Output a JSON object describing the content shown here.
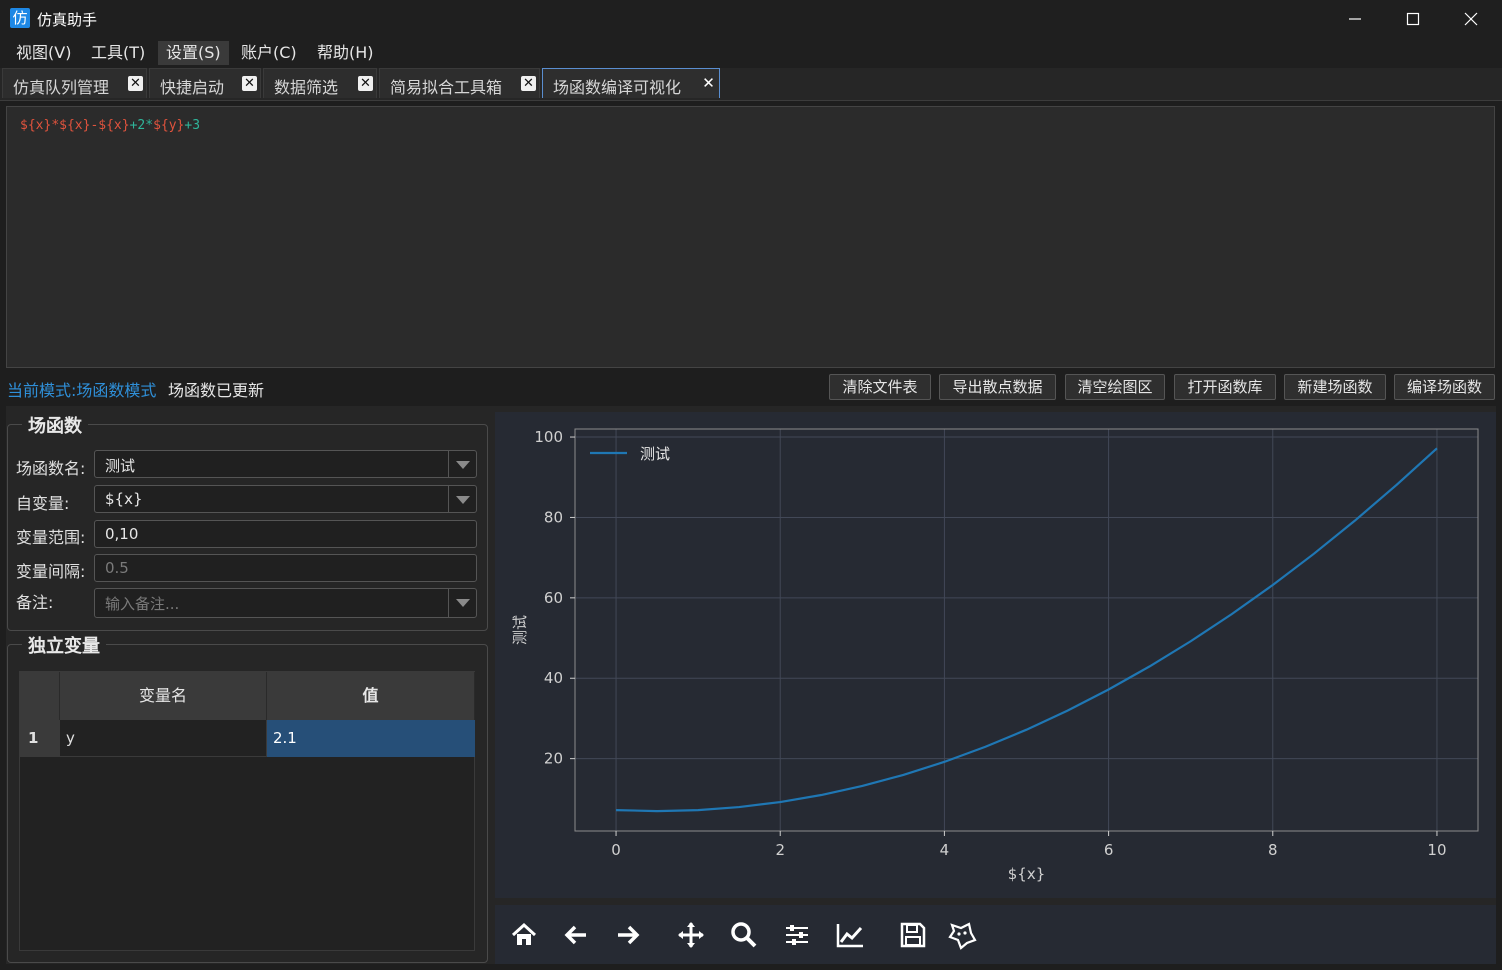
{
  "window": {
    "title": "仿真助手",
    "icon_glyph": "仿"
  },
  "menu": [
    "视图(V)",
    "工具(T)",
    "设置(S)",
    "账户(C)",
    "帮助(H)"
  ],
  "tabs": [
    "仿真队列管理",
    "快捷启动",
    "数据筛选",
    "简易拟合工具箱",
    "场函数编译可视化"
  ],
  "editor": {
    "tokens": [
      {
        "t": "${x}",
        "k": "var"
      },
      {
        "t": "*",
        "k": "var"
      },
      {
        "t": "${x}",
        "k": "var"
      },
      {
        "t": "-",
        "k": "var"
      },
      {
        "t": "${x}",
        "k": "var"
      },
      {
        "t": "+2*",
        "k": "num"
      },
      {
        "t": "${y}",
        "k": "var"
      },
      {
        "t": "+3",
        "k": "num"
      }
    ]
  },
  "status": {
    "mode": "当前模式:场函数模式",
    "message": "场函数已更新"
  },
  "actions": [
    "清除文件表",
    "导出散点数据",
    "清空绘图区",
    "打开函数库",
    "新建场函数",
    "编译场函数"
  ],
  "field_group": {
    "title": "场函数",
    "name_label": "场函数名:",
    "name_value": "测试",
    "var_label": "自变量:",
    "var_value": "${x}",
    "range_label": "变量范围:",
    "range_value": "0,10",
    "interval_label": "变量间隔:",
    "interval_placeholder": "0.5",
    "note_label": "备注:",
    "note_placeholder": "输入备注..."
  },
  "indep_group": {
    "title": "独立变量",
    "columns": [
      "变量名",
      "值"
    ],
    "rows": [
      {
        "index": "1",
        "name": "y",
        "value": "2.1"
      }
    ]
  },
  "colors": {
    "accent": "#2f8fd8",
    "line": "#1f77b4",
    "selected_cell": "#264f78"
  },
  "chart_data": {
    "type": "line",
    "xlabel": "${x}",
    "ylabel": "测试",
    "xlim": [
      -0.5,
      10.5
    ],
    "ylim": [
      2,
      102
    ],
    "xticks": [
      0,
      2,
      4,
      6,
      8,
      10
    ],
    "yticks": [
      20,
      40,
      60,
      80,
      100
    ],
    "grid": true,
    "legend": "top-left",
    "series": [
      {
        "name": "测试",
        "x": [
          0,
          0.5,
          1,
          1.5,
          2,
          2.5,
          3,
          3.5,
          4,
          4.5,
          5,
          5.5,
          6,
          6.5,
          7,
          7.5,
          8,
          8.5,
          9,
          9.5,
          10
        ],
        "y": [
          7.2,
          6.95,
          7.2,
          7.95,
          9.2,
          10.95,
          13.2,
          15.95,
          19.2,
          22.95,
          27.2,
          31.95,
          37.2,
          42.95,
          49.2,
          55.95,
          63.2,
          70.95,
          79.2,
          87.95,
          97.2
        ]
      }
    ]
  },
  "toolbar_icons": [
    "home-icon",
    "back-icon",
    "forward-icon",
    "pan-icon",
    "zoom-icon",
    "configure-subplots-icon",
    "edit-axes-icon",
    "save-icon",
    "customize-icon"
  ]
}
